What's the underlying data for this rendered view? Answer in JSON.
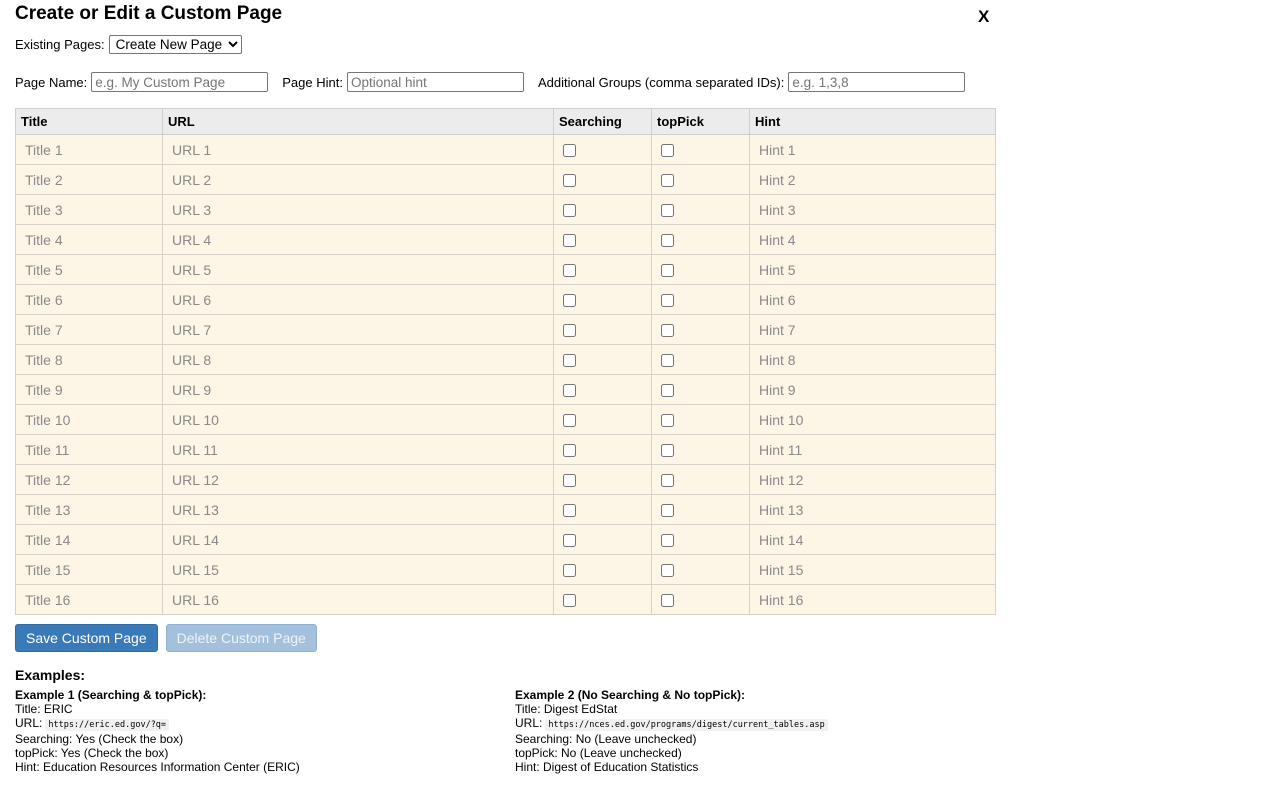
{
  "dialog": {
    "title": "Create or Edit a Custom Page",
    "close_label": "X"
  },
  "existing_pages": {
    "label": "Existing Pages:",
    "selected": "Create New Page"
  },
  "fields": {
    "page_name_label": "Page Name:",
    "page_name_placeholder": "e.g. My Custom Page",
    "page_hint_label": "Page Hint:",
    "page_hint_placeholder": "Optional hint",
    "groups_label": "Additional Groups (comma separated IDs):",
    "groups_placeholder": "e.g. 1,3,8"
  },
  "table": {
    "headers": [
      "Title",
      "URL",
      "Searching",
      "topPick",
      "Hint"
    ],
    "rows": [
      {
        "title": "Title 1",
        "url": "URL 1",
        "hint": "Hint 1"
      },
      {
        "title": "Title 2",
        "url": "URL 2",
        "hint": "Hint 2"
      },
      {
        "title": "Title 3",
        "url": "URL 3",
        "hint": "Hint 3"
      },
      {
        "title": "Title 4",
        "url": "URL 4",
        "hint": "Hint 4"
      },
      {
        "title": "Title 5",
        "url": "URL 5",
        "hint": "Hint 5"
      },
      {
        "title": "Title 6",
        "url": "URL 6",
        "hint": "Hint 6"
      },
      {
        "title": "Title 7",
        "url": "URL 7",
        "hint": "Hint 7"
      },
      {
        "title": "Title 8",
        "url": "URL 8",
        "hint": "Hint 8"
      },
      {
        "title": "Title 9",
        "url": "URL 9",
        "hint": "Hint 9"
      },
      {
        "title": "Title 10",
        "url": "URL 10",
        "hint": "Hint 10"
      },
      {
        "title": "Title 11",
        "url": "URL 11",
        "hint": "Hint 11"
      },
      {
        "title": "Title 12",
        "url": "URL 12",
        "hint": "Hint 12"
      },
      {
        "title": "Title 13",
        "url": "URL 13",
        "hint": "Hint 13"
      },
      {
        "title": "Title 14",
        "url": "URL 14",
        "hint": "Hint 14"
      },
      {
        "title": "Title 15",
        "url": "URL 15",
        "hint": "Hint 15"
      },
      {
        "title": "Title 16",
        "url": "URL 16",
        "hint": "Hint 16"
      }
    ]
  },
  "buttons": {
    "save": "Save Custom Page",
    "delete": "Delete Custom Page"
  },
  "examples": {
    "heading": "Examples:",
    "ex1": {
      "heading": "Example 1 (Searching & topPick):",
      "title": "Title: ERIC",
      "url_label": "URL:",
      "url": "https://eric.ed.gov/?q=",
      "searching": "Searching: Yes (Check the box)",
      "toppick": "topPick: Yes (Check the box)",
      "hint": "Hint: Education Resources Information Center (ERIC)"
    },
    "ex2": {
      "heading": "Example 2 (No Searching & No topPick):",
      "title": "Title: Digest EdStat",
      "url_label": "URL:",
      "url": "https://nces.ed.gov/programs/digest/current_tables.asp",
      "searching": "Searching: No (Leave unchecked)",
      "toppick": "topPick: No (Leave unchecked)",
      "hint": "Hint: Digest of Education Statistics"
    }
  }
}
